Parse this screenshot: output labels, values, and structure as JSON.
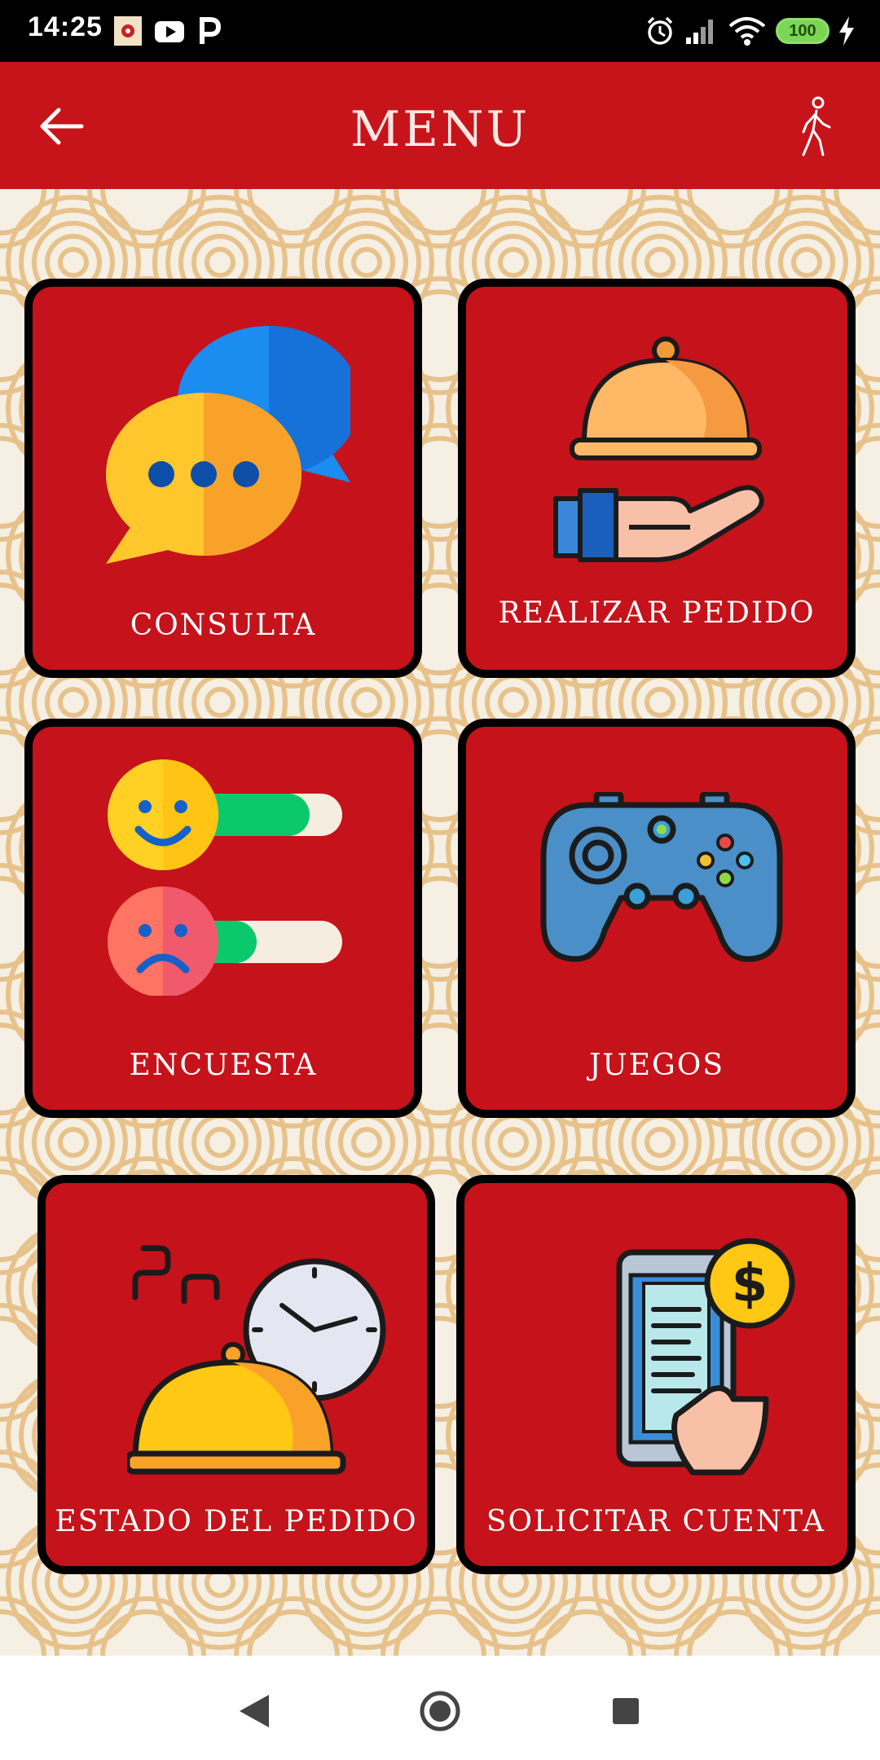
{
  "status_bar": {
    "time": "14:25",
    "battery": "100",
    "icons": [
      "app-notification-icon",
      "youtube-icon",
      "parking-p-icon",
      "alarm-icon",
      "signal-icon",
      "wifi-icon",
      "battery-icon",
      "charging-icon"
    ]
  },
  "app_bar": {
    "title": "MENU",
    "back_icon": "arrow-left-icon",
    "right_icon": "walking-person-icon"
  },
  "menu": {
    "items": [
      {
        "label": "CONSULTA",
        "icon": "chat-bubbles-icon"
      },
      {
        "label": "REALIZAR PEDIDO",
        "icon": "serving-cloche-hand-icon"
      },
      {
        "label": "ENCUESTA",
        "icon": "survey-faces-icon"
      },
      {
        "label": "JUEGOS",
        "icon": "gamepad-icon"
      },
      {
        "label": "ESTADO DEL PEDIDO",
        "icon": "cloche-clock-icon"
      },
      {
        "label": "SOLICITAR CUENTA",
        "icon": "phone-bill-icon"
      }
    ]
  },
  "colors": {
    "primary": "#c6141a",
    "card": "#c6121a",
    "pattern": "#e2b36c",
    "background": "#f5efe4"
  },
  "nav_bar": {
    "icons": [
      "back-triangle-icon",
      "home-circle-icon",
      "recents-square-icon"
    ]
  }
}
